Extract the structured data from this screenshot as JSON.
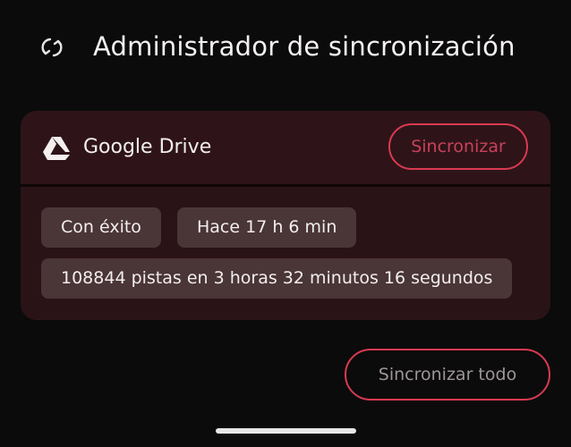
{
  "header": {
    "title": "Administrador de sincronización",
    "icon": "sync-icon"
  },
  "service": {
    "name": "Google Drive",
    "icon": "google-drive-icon",
    "sync_label": "Sincronizar",
    "status": "Con éxito",
    "last_sync": "Hace 17 h 6 min",
    "details": "108844 pistas en 3 horas 32 minutos 16 segundos"
  },
  "actions": {
    "sync_all_label": "Sincronizar todo"
  },
  "colors": {
    "background": "#0b0b0b",
    "card": "#2a1317",
    "chip": "#4a3537",
    "accent": "#d93a52"
  }
}
